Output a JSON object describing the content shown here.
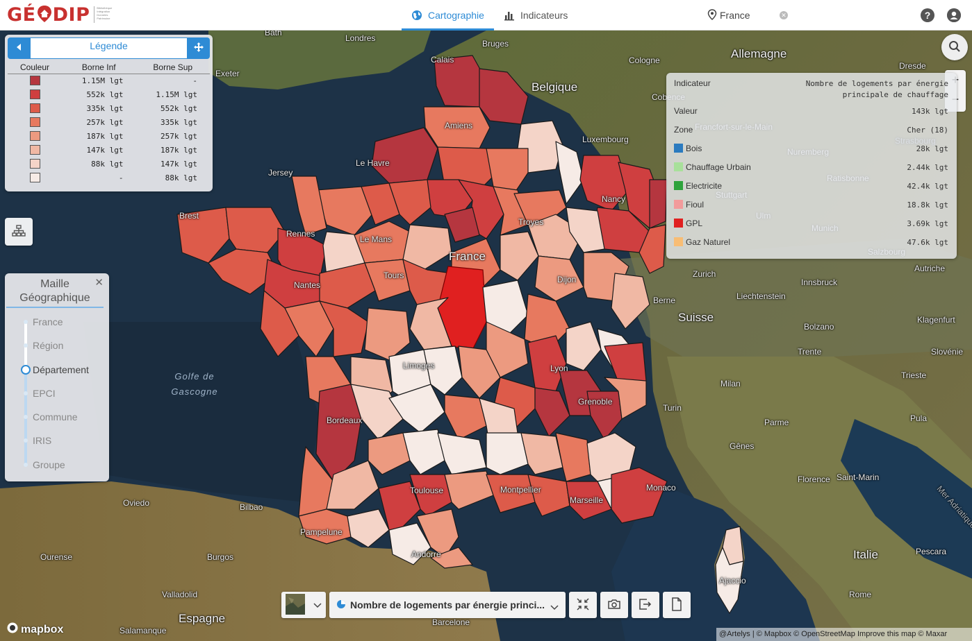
{
  "app": {
    "logo": "GÉODIP",
    "logo_tagline": "Bibliothèque Intégration Données Patrimoine"
  },
  "nav": {
    "tabs": [
      {
        "label": "Cartographie",
        "icon": "globe-icon",
        "active": true
      },
      {
        "label": "Indicateurs",
        "icon": "bar-chart-icon",
        "active": false
      }
    ]
  },
  "zone_search": {
    "value": "France"
  },
  "legend": {
    "title": "Légende",
    "headers": [
      "Couleur",
      "Borne Inf",
      "Borne Sup"
    ],
    "rows": [
      {
        "color": "#b5363f",
        "inf": "1.15M lgt",
        "sup": "-"
      },
      {
        "color": "#cf3f40",
        "inf": "552k lgt",
        "sup": "1.15M lgt"
      },
      {
        "color": "#dd5b4a",
        "inf": "335k lgt",
        "sup": "552k lgt"
      },
      {
        "color": "#e7795f",
        "inf": "257k lgt",
        "sup": "335k lgt"
      },
      {
        "color": "#ec9a80",
        "inf": "187k lgt",
        "sup": "257k lgt"
      },
      {
        "color": "#f0b8a4",
        "inf": "147k lgt",
        "sup": "187k lgt"
      },
      {
        "color": "#f4d4c8",
        "inf": "88k lgt",
        "sup": "147k lgt"
      },
      {
        "color": "#f6ebe6",
        "inf": "-",
        "sup": "88k lgt"
      }
    ]
  },
  "maille": {
    "title_1": "Maille",
    "title_2": "Géographique",
    "levels": [
      "France",
      "Région",
      "Département",
      "EPCI",
      "Commune",
      "IRIS",
      "Groupe"
    ],
    "selected": "Département"
  },
  "info": {
    "indicateur_label": "Indicateur",
    "indicateur_value_1": "Nombre de logements par énergie",
    "indicateur_value_2": "principale de chauffage",
    "valeur_label": "Valeur",
    "valeur_value": "143k lgt",
    "zone_label": "Zone",
    "zone_value": "Cher (18)",
    "energies": [
      {
        "name": "Bois",
        "value": "28k lgt",
        "color": "#2b7bbf"
      },
      {
        "name": "Chauffage Urbain",
        "value": "2.44k lgt",
        "color": "#a8e09a"
      },
      {
        "name": "Electricite",
        "value": "42.4k lgt",
        "color": "#2fa33c"
      },
      {
        "name": "Fioul",
        "value": "18.8k lgt",
        "color": "#f29b9b"
      },
      {
        "name": "GPL",
        "value": "3.69k lgt",
        "color": "#e02020"
      },
      {
        "name": "Gaz Naturel",
        "value": "47.6k lgt",
        "color": "#f8bd74"
      }
    ]
  },
  "map_labels": {
    "places": [
      "Londres",
      "Bath",
      "Exeter",
      "Bruges",
      "Calais",
      "Amiens",
      "Belgique",
      "Cologne",
      "Luxembourg",
      "Allemagne",
      "Dresde",
      "Francfort-sur-le-Main",
      "Nuremberg",
      "Ratisbonne",
      "Stuttgart",
      "Ulm",
      "Munich",
      "Salzbourg",
      "Autriche",
      "Innsbruck",
      "Zurich",
      "Liechtenstein",
      "Berne",
      "Suisse",
      "Bolzano",
      "Klagenfurt",
      "Slovénie",
      "Trente",
      "Trieste",
      "Milan",
      "Turin",
      "Gênes",
      "Parme",
      "Pula",
      "Florence",
      "Saint-Marin",
      "Monaco",
      "Italie",
      "Pescara",
      "Rome",
      "Jersey",
      "Brest",
      "Rennes",
      "Le Mans",
      "Tours",
      "Nantes",
      "France",
      "Troyes",
      "Dijon",
      "Lyon",
      "Grenoble",
      "Bordeaux",
      "Toulouse",
      "Montpellier",
      "Marseille",
      "Limoges",
      "Andorre",
      "Ajaccio",
      "Bilbao",
      "Oviedo",
      "Pampelune",
      "Burgos",
      "Ourense",
      "Valladolid",
      "Salamanque",
      "Espagne",
      "Barcelone",
      "Cobence",
      "Nancy",
      "Strasbourg",
      "Mer Adriatique",
      "Le Havre"
    ],
    "sea": "Golfe de Gascogne"
  },
  "toolbar": {
    "indicator_select": "Nombre de logements par énergie princi..."
  },
  "attribution": "@Artelys | © Mapbox © OpenStreetMap Improve this map © Maxar",
  "mapbox_label": "mapbox"
}
